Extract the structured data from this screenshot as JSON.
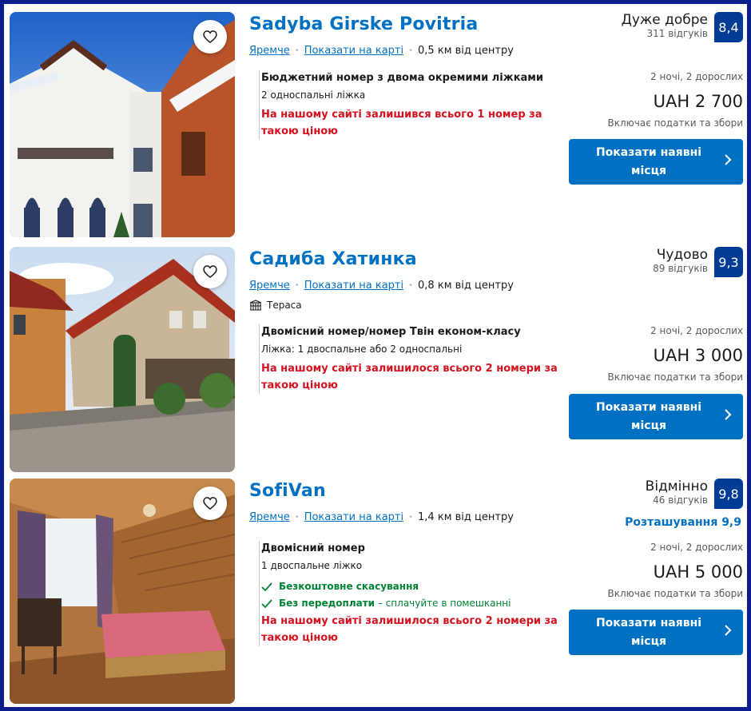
{
  "listings": [
    {
      "name": "Sadyba Girske Povitria",
      "city": "Яремче",
      "map_link": "Показати на карті",
      "distance": "0,5 км від центру",
      "room_title": "Бюджетний номер з двома окремими ліжками",
      "beds": "2 односпальні ліжка",
      "scarcity": "На нашому сайті залишився всього 1 номер за такою ціною",
      "rating_word": "Дуже добре",
      "reviews": "311 відгуків",
      "score": "8,4",
      "stay": "2 ночі, 2 дорослих",
      "price": "UAH 2 700",
      "taxes": "Включає податки та збори",
      "cta": "Показати наявні місця"
    },
    {
      "name": "Садиба Хатинка",
      "city": "Яремче",
      "map_link": "Показати на карті",
      "distance": "0,8 км від центру",
      "amenity": "Тераса",
      "room_title": "Двомісний номер/номер Твін економ-класу",
      "beds": "Ліжка: 1 двоспальне або 2 односпальні",
      "scarcity": "На нашому сайті залишилося всього 2 номери за такою ціною",
      "rating_word": "Чудово",
      "reviews": "89 відгуків",
      "score": "9,3",
      "stay": "2 ночі, 2 дорослих",
      "price": "UAH 3 000",
      "taxes": "Включає податки та збори",
      "cta": "Показати наявні місця"
    },
    {
      "name": "SofiVan",
      "city": "Яремче",
      "map_link": "Показати на карті",
      "distance": "1,4 км від центру",
      "room_title": "Двомісний номер",
      "beds": "1 двоспальне ліжко",
      "feature_free_cancel": "Безкоштовне скасування",
      "feature_no_prepay": "Без передоплати",
      "feature_no_prepay_sub": " – сплачуйте в помешканні",
      "scarcity": "На нашому сайті залишилося всього 2 номери за такою ціною",
      "rating_word": "Відмінно",
      "reviews": "46 відгуків",
      "score": "9,8",
      "location_score": "Розташування 9,9",
      "stay": "2 ночі, 2 дорослих",
      "price": "UAH 5 000",
      "taxes": "Включає податки та збори",
      "cta": "Показати наявні місця"
    }
  ],
  "colors": {
    "brand_blue": "#0071c2",
    "score_navy": "#003b95",
    "urgent_red": "#d4111e",
    "positive_green": "#008234",
    "frame_border": "#0b1f8c"
  },
  "icons": {
    "favorite": "heart-outline-icon",
    "cta": "chevron-right-icon",
    "amenity": "terrace-icon",
    "feature": "checkmark-icon"
  }
}
